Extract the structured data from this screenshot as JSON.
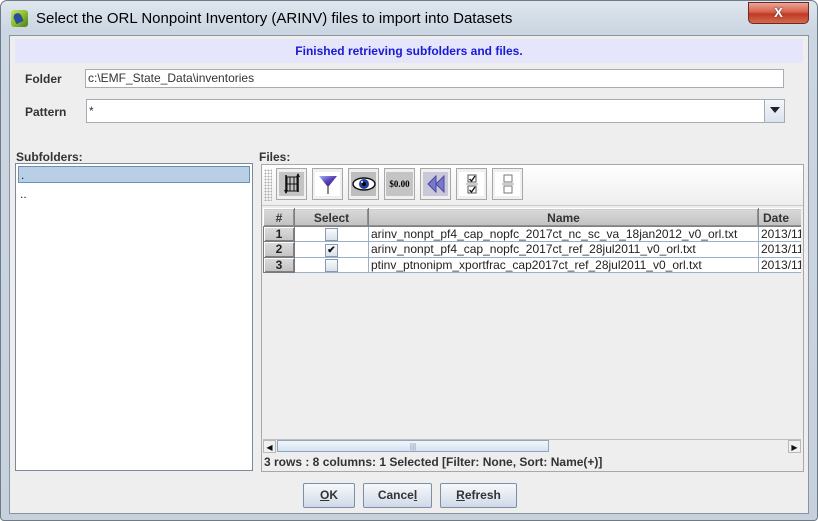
{
  "window": {
    "title": "Select the ORL Nonpoint Inventory (ARINV) files to import into Datasets",
    "close_label": "X"
  },
  "status_message": "Finished retrieving subfolders and files.",
  "folder": {
    "label": "Folder",
    "value": "c:\\EMF_State_Data\\inventories"
  },
  "pattern": {
    "label": "Pattern",
    "value": "*"
  },
  "subfolders": {
    "label": "Subfolders:",
    "items": [
      {
        "label": ".",
        "selected": true
      },
      {
        "label": "..",
        "selected": false
      }
    ]
  },
  "files": {
    "label": "Files:",
    "toolbar": [
      {
        "name": "sort-icon",
        "tooltip": "Sort"
      },
      {
        "name": "filter-icon",
        "tooltip": "Filter"
      },
      {
        "name": "view-eye-icon",
        "tooltip": "Show/Hide Columns"
      },
      {
        "name": "format-currency-icon",
        "tooltip": "Format",
        "glyph": "$0.00"
      },
      {
        "name": "reset-icon",
        "tooltip": "Reset"
      },
      {
        "name": "select-all-icon",
        "tooltip": "Select All"
      },
      {
        "name": "clear-all-icon",
        "tooltip": "Clear All"
      }
    ],
    "columns": [
      "#",
      "Select",
      "Name",
      "Date"
    ],
    "rows": [
      {
        "num": "1",
        "selected": false,
        "name": "arinv_nonpt_pf4_cap_nopfc_2017ct_nc_sc_va_18jan2012_v0_orl.txt",
        "date": "2013/11"
      },
      {
        "num": "2",
        "selected": true,
        "name": "arinv_nonpt_pf4_cap_nopfc_2017ct_ref_28jul2011_v0_orl.txt",
        "date": "2013/11"
      },
      {
        "num": "3",
        "selected": false,
        "name": "ptinv_ptnonipm_xportfrac_cap2017ct_ref_28jul2011_v0_orl.txt",
        "date": "2013/11"
      }
    ],
    "status": "3 rows : 8 columns: 1 Selected [Filter: None, Sort: Name(+)]"
  },
  "buttons": {
    "ok": {
      "mnemonic": "O",
      "rest": "K"
    },
    "cancel": {
      "pre": "Cance",
      "mnemonic": "l"
    },
    "refresh": {
      "mnemonic": "R",
      "rest": "efresh"
    }
  },
  "colors": {
    "banner_bg": "#e5e5fb",
    "banner_text": "#1a1ad4",
    "selection": "#b8cfe5",
    "close_red": "#c03a25"
  }
}
